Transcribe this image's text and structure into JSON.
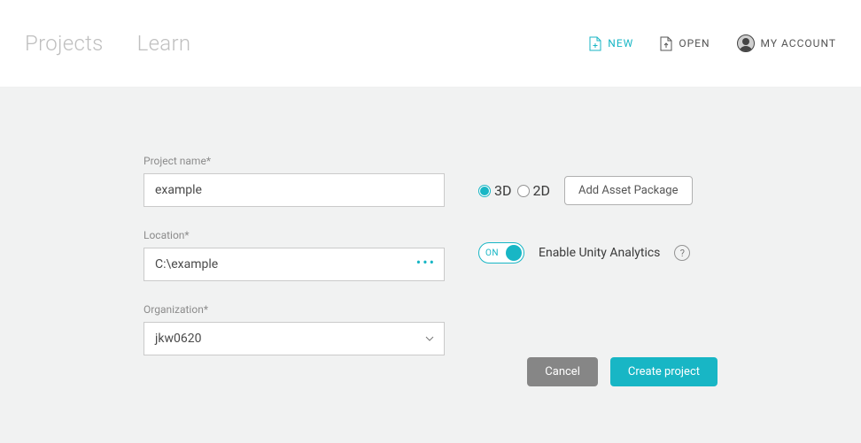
{
  "header": {
    "tabs": {
      "projects": "Projects",
      "learn": "Learn"
    },
    "actions": {
      "new": "NEW",
      "open": "OPEN",
      "account": "MY ACCOUNT"
    }
  },
  "form": {
    "project_name": {
      "label": "Project name*",
      "value": "example"
    },
    "location": {
      "label": "Location*",
      "value": "C:\\example"
    },
    "organization": {
      "label": "Organization*",
      "value": "jkw0620"
    },
    "dimension": {
      "option_3d": "3D",
      "option_2d": "2D",
      "selected": "3D"
    },
    "add_asset_label": "Add Asset Package",
    "analytics": {
      "toggle_state": "ON",
      "label": "Enable Unity Analytics",
      "help": "?"
    }
  },
  "buttons": {
    "cancel": "Cancel",
    "create": "Create project"
  },
  "colors": {
    "accent": "#18b6c5",
    "muted": "#8c8c8c",
    "bg": "#f1f2f2"
  }
}
